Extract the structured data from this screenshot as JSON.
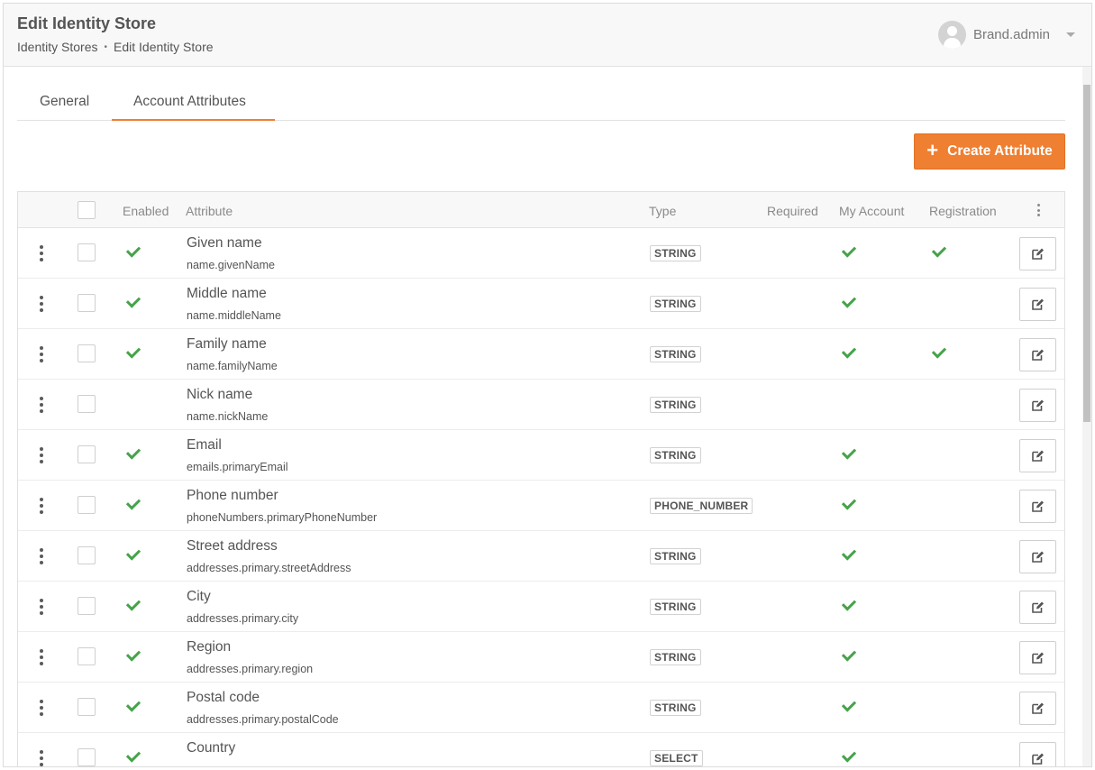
{
  "header": {
    "title": "Edit Identity Store",
    "breadcrumb": [
      "Identity Stores",
      "Edit Identity Store"
    ],
    "breadcrumb_separator": "•",
    "user_name": "Brand.admin"
  },
  "tabs": [
    {
      "label": "General",
      "active": false
    },
    {
      "label": "Account Attributes",
      "active": true
    }
  ],
  "create_button": {
    "label": "Create Attribute",
    "icon": "plus-icon"
  },
  "table": {
    "columns": [
      "Enabled",
      "Attribute",
      "Type",
      "Required",
      "My Account",
      "Registration"
    ],
    "rows": [
      {
        "name": "Given name",
        "path": "name.givenName",
        "type": "STRING",
        "enabled": true,
        "required": false,
        "my_account": true,
        "registration": true
      },
      {
        "name": "Middle name",
        "path": "name.middleName",
        "type": "STRING",
        "enabled": true,
        "required": false,
        "my_account": true,
        "registration": false
      },
      {
        "name": "Family name",
        "path": "name.familyName",
        "type": "STRING",
        "enabled": true,
        "required": false,
        "my_account": true,
        "registration": true
      },
      {
        "name": "Nick name",
        "path": "name.nickName",
        "type": "STRING",
        "enabled": false,
        "required": false,
        "my_account": false,
        "registration": false
      },
      {
        "name": "Email",
        "path": "emails.primaryEmail",
        "type": "STRING",
        "enabled": true,
        "required": false,
        "my_account": true,
        "registration": false
      },
      {
        "name": "Phone number",
        "path": "phoneNumbers.primaryPhoneNumber",
        "type": "PHONE_NUMBER",
        "enabled": true,
        "required": false,
        "my_account": true,
        "registration": false
      },
      {
        "name": "Street address",
        "path": "addresses.primary.streetAddress",
        "type": "STRING",
        "enabled": true,
        "required": false,
        "my_account": true,
        "registration": false
      },
      {
        "name": "City",
        "path": "addresses.primary.city",
        "type": "STRING",
        "enabled": true,
        "required": false,
        "my_account": true,
        "registration": false
      },
      {
        "name": "Region",
        "path": "addresses.primary.region",
        "type": "STRING",
        "enabled": true,
        "required": false,
        "my_account": true,
        "registration": false
      },
      {
        "name": "Postal code",
        "path": "addresses.primary.postalCode",
        "type": "STRING",
        "enabled": true,
        "required": false,
        "my_account": true,
        "registration": false
      },
      {
        "name": "Country",
        "path": "",
        "type": "SELECT",
        "enabled": true,
        "required": false,
        "my_account": true,
        "registration": false
      }
    ]
  },
  "colors": {
    "accent": "#ef7f31",
    "check": "#46a34a",
    "header_bg": "#f8f8f8"
  }
}
